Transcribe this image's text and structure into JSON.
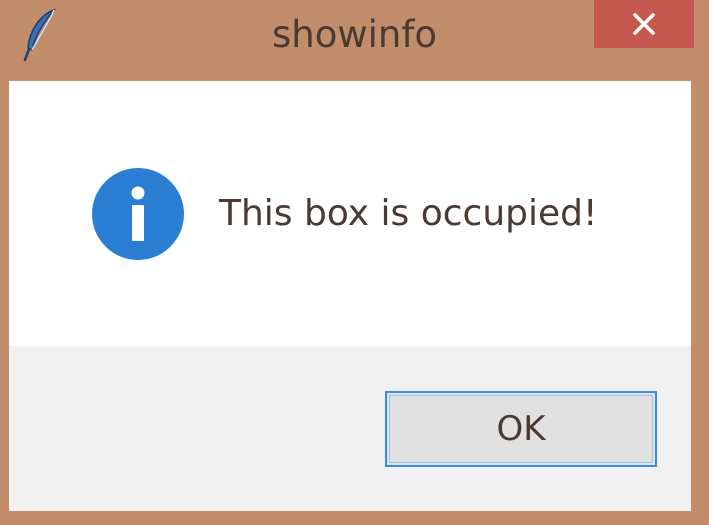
{
  "window": {
    "title": "showinfo",
    "app_icon": "feather-icon",
    "close_icon": "close-icon"
  },
  "dialog": {
    "icon": "info-icon",
    "message": "This box is occupied!",
    "ok_label": "OK"
  },
  "colors": {
    "frame": "#c28d6b",
    "close_button": "#c6574f",
    "info_blue": "#2a7fd4",
    "button_focus": "#3c8ce6",
    "text": "#4a3a34"
  }
}
